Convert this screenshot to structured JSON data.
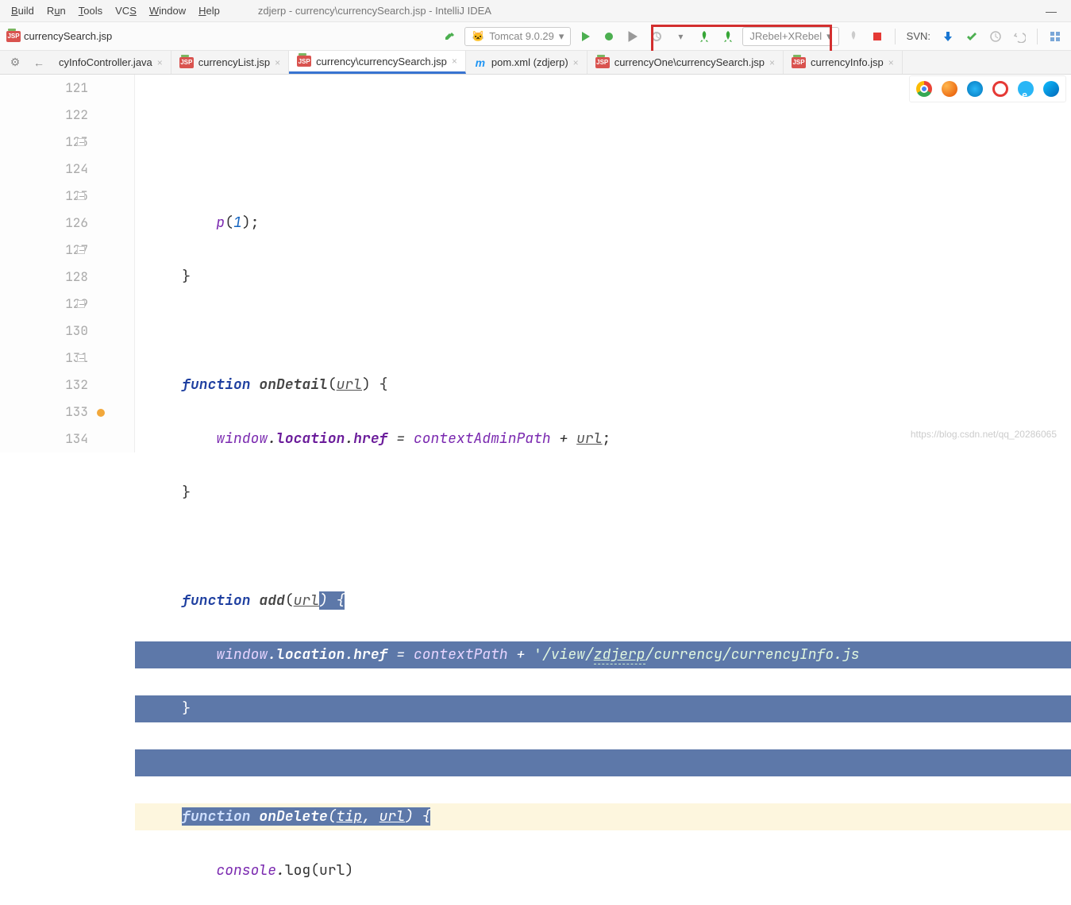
{
  "menu": {
    "build": "Build",
    "run": "Run",
    "tools": "Tools",
    "vcs": "VCS",
    "window": "Window",
    "help": "Help"
  },
  "title": "zdjerp - currency\\currencySearch.jsp - IntelliJ IDEA",
  "navFile": "currencySearch.jsp",
  "runConfig": "Tomcat 9.0.29",
  "jrebelConfig": "JRebel+XRebel",
  "svnLabel": "SVN:",
  "tabs": [
    {
      "label": "cyInfoController.java"
    },
    {
      "label": "currencyList.jsp"
    },
    {
      "label": "currency\\currencySearch.jsp",
      "active": true
    },
    {
      "label": "pom.xml (zdjerp)"
    },
    {
      "label": "currencyOne\\currencySearch.jsp"
    },
    {
      "label": "currencyInfo.jsp"
    }
  ],
  "lines": [
    "121",
    "122",
    "123",
    "124",
    "125",
    "126",
    "127",
    "128",
    "129",
    "130",
    "131",
    "132",
    "133",
    "134"
  ],
  "code": {
    "l122": "p",
    "l122b": "(",
    "l122n": "1",
    "l122c": ");",
    "l123": "}",
    "l125a": "function",
    "l125b": "onDetail",
    "l125c": "url",
    "l125d": ") {",
    "l126a": "window",
    "l126b": "location",
    "l126c": "href",
    "l126d": "contextAdminPath",
    "l126e": "url",
    "l127": "}",
    "l129a": "function",
    "l129b": "add",
    "l129c": "url",
    "l129d": ") {",
    "l130a": "window",
    "l130b": "location",
    "l130c": "href",
    "l130d": "contextPath",
    "l130e": "'/view/zdjerp/currency/currencyInfo.js",
    "l131": "}",
    "l133a": "function",
    "l133b": "onDelete",
    "l133c": "tip",
    "l133d": "url",
    "l133e": ") {",
    "l134a": "console",
    "l134b": "log",
    "l134c": "url"
  },
  "watermark": "https://blog.csdn.net/qq_20286065"
}
